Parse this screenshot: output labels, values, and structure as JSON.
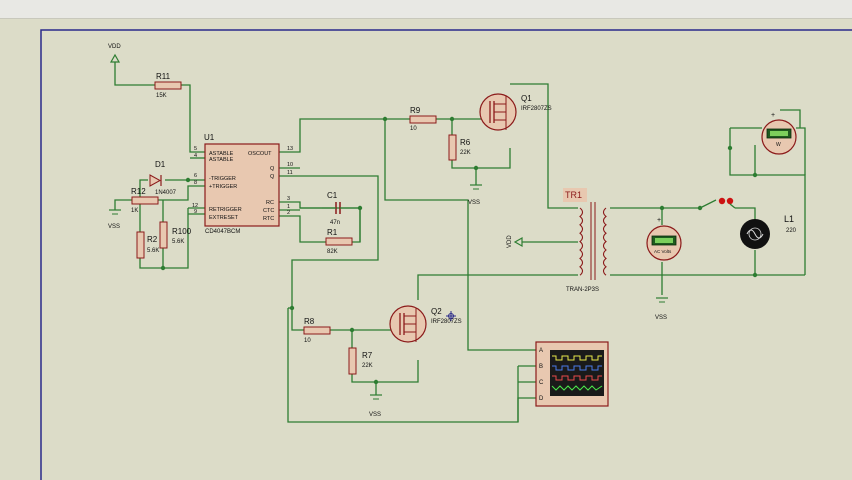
{
  "labels": {
    "vdd_top": "VDD",
    "vdd_side": "VDD",
    "vss_left": "VSS",
    "vss_r6": "VSS",
    "vss_r7": "VSS",
    "vss_meter": "VSS"
  },
  "components": {
    "u1": {
      "ref": "U1",
      "part": "CD4047BCM",
      "pins_left": [
        "ASTABLE",
        "ASTABLE",
        "-TRIGGER",
        "+TRIGGER",
        "RETRIGGER",
        "EXTRESET"
      ],
      "pins_right": [
        "OSCOUT",
        "Q",
        "Q",
        "RC",
        "CTC",
        "RTC"
      ],
      "pin_nums_left": [
        "5",
        "4",
        "6",
        "8",
        "12",
        "9"
      ],
      "pin_nums_right": [
        "13",
        "10",
        "11",
        "3",
        "1",
        "2"
      ]
    },
    "r11": {
      "ref": "R11",
      "value": "15K"
    },
    "d1": {
      "ref": "D1",
      "part": "1N4007"
    },
    "r12": {
      "ref": "R12",
      "value": "1K"
    },
    "r2": {
      "ref": "R2",
      "value": "5.6K"
    },
    "r100": {
      "ref": "R100",
      "value": "5.6K"
    },
    "c1": {
      "ref": "C1",
      "value": "47n"
    },
    "r1": {
      "ref": "R1",
      "value": "82K"
    },
    "r9": {
      "ref": "R9",
      "value": "10"
    },
    "r6": {
      "ref": "R6",
      "value": "22K"
    },
    "q1": {
      "ref": "Q1",
      "part": "IRF2807ZS"
    },
    "tr1": {
      "ref": "TR1",
      "part": "TRAN-2P3S"
    },
    "r8": {
      "ref": "R8",
      "value": "10"
    },
    "r7": {
      "ref": "R7",
      "value": "22K"
    },
    "q2": {
      "ref": "Q2",
      "part": "IRF2807ZS"
    },
    "l1": {
      "ref": "L1",
      "value": "220"
    },
    "wattmeter": {
      "unit": "W"
    },
    "voltmeter": {
      "unit": "AC Volts"
    },
    "oscilloscope": {
      "channels": [
        "A",
        "B",
        "C",
        "D"
      ]
    }
  },
  "colors": {
    "background": "#dcdcc8",
    "wire": "#2e7d32",
    "component_outline": "#8b1a1a",
    "component_fill": "#e8c8b0",
    "scope_screen": "#1a1a1a",
    "border": "#2a2a8a"
  }
}
